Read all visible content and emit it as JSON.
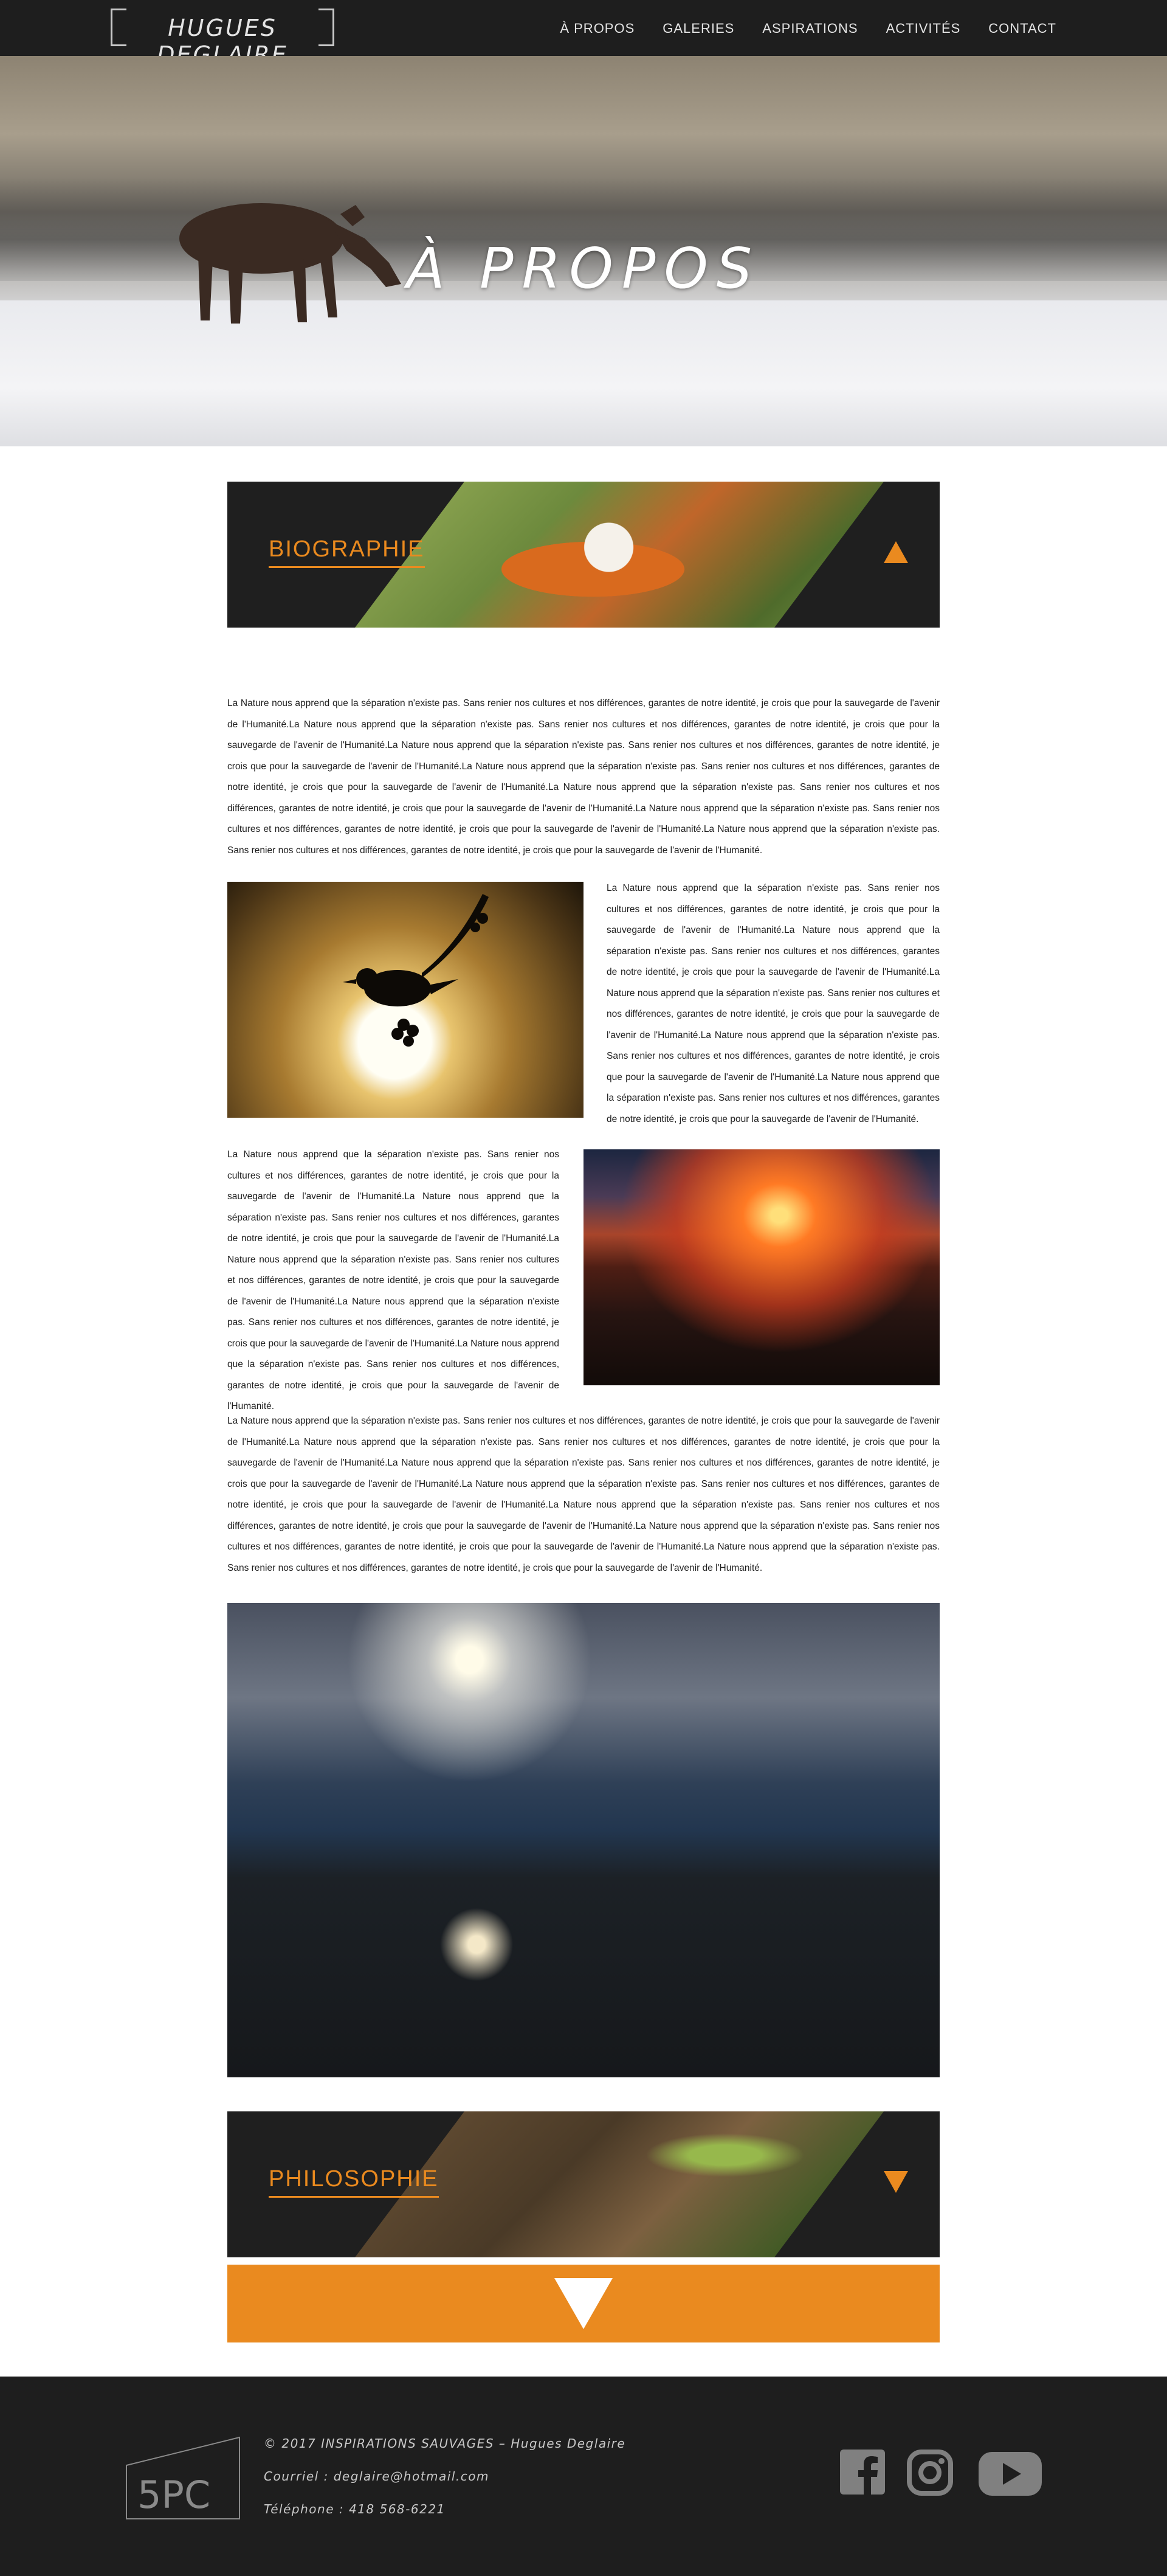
{
  "header": {
    "logo_text": "HUGUES DEGLAIRE",
    "nav": [
      "À PROPOS",
      "GALERIES",
      "ASPIRATIONS",
      "ACTIVITÉS",
      "CONTACT"
    ]
  },
  "hero": {
    "title": "À PROPOS"
  },
  "biography": {
    "label": "BIOGRAPHIE",
    "arrow_icon": "triangle-up-icon",
    "paragraph_1": "La Nature nous apprend que la séparation n'existe pas. Sans renier nos cultures et nos différences, garantes de notre identité, je crois que pour la sauvegarde de l'avenir de l'Humanité.La Nature nous apprend que la séparation n'existe pas. Sans renier nos cultures et nos différences, garantes de notre identité, je crois que pour la sauvegarde de l'avenir de l'Humanité.La Nature nous apprend que la séparation n'existe pas. Sans renier nos cultures et nos différences, garantes de notre identité, je crois que pour la sauvegarde de l'avenir de l'Humanité.La Nature nous apprend que la séparation n'existe pas. Sans renier nos cultures et nos différences, garantes de notre identité, je crois que pour la sauvegarde de l'avenir de l'Humanité.La Nature nous apprend que la séparation n'existe pas. Sans renier nos cultures et nos différences, garantes de notre identité, je crois que pour la sauvegarde de l'avenir de l'Humanité.La Nature nous apprend que la séparation n'existe pas. Sans renier nos cultures et nos différences, garantes de notre identité, je crois que pour la sauvegarde de l'avenir de l'Humanité.La Nature nous apprend que la séparation n'existe pas. Sans renier nos cultures et nos différences, garantes de notre identité, je crois que pour la sauvegarde de l'avenir de l'Humanité.",
    "paragraph_2": "La Nature nous apprend que la séparation n'existe pas. Sans renier nos cultures et nos différences, garantes de notre identité, je crois que pour la sauvegarde de l'avenir de l'Humanité.La Nature nous apprend que la séparation n'existe pas. Sans renier nos cultures et nos différences, garantes de notre identité, je crois que pour la sauvegarde de l'avenir de l'Humanité.La Nature nous apprend que la séparation n'existe pas. Sans renier nos cultures et nos différences, garantes de notre identité, je crois que pour la sauvegarde de l'avenir de l'Humanité.La Nature nous apprend que la séparation n'existe pas. Sans renier nos cultures et nos différences, garantes de notre identité, je crois que pour la sauvegarde de l'avenir de l'Humanité.La Nature nous apprend que la séparation n'existe pas. Sans renier nos cultures et nos différences, garantes de notre identité, je crois que pour la sauvegarde de l'avenir de l'Humanité.",
    "paragraph_3": "La Nature nous apprend que la séparation n'existe pas. Sans renier nos cultures et nos différences, garantes de notre identité, je crois que pour la sauvegarde de l'avenir de l'Humanité.La Nature nous apprend que la séparation n'existe pas. Sans renier nos cultures et nos différences, garantes de notre identité, je crois que pour la sauvegarde de l'avenir de l'Humanité.La Nature nous apprend que la séparation n'existe pas. Sans renier nos cultures et nos différences, garantes de notre identité, je crois que pour la sauvegarde de l'avenir de l'Humanité.La Nature nous apprend que la séparation n'existe pas. Sans renier nos cultures et nos différences, garantes de notre identité, je crois que pour la sauvegarde de l'avenir de l'Humanité.La Nature nous apprend que la séparation n'existe pas. Sans renier nos cultures et nos différences, garantes de notre identité, je crois que pour la sauvegarde de l'avenir de l'Humanité.",
    "paragraph_4": "La Nature nous apprend que la séparation n'existe pas. Sans renier nos cultures et nos différences, garantes de notre identité, je crois que pour la sauvegarde de l'avenir de l'Humanité.La Nature nous apprend que la séparation n'existe pas. Sans renier nos cultures et nos différences, garantes de notre identité, je crois que pour la sauvegarde de l'avenir de l'Humanité.La Nature nous apprend que la séparation n'existe pas. Sans renier nos cultures et nos différences, garantes de notre identité, je crois que pour la sauvegarde de l'avenir de l'Humanité.La Nature nous apprend que la séparation n'existe pas. Sans renier nos cultures et nos différences, garantes de notre identité, je crois que pour la sauvegarde de l'avenir de l'Humanité.La Nature nous apprend que la séparation n'existe pas. Sans renier nos cultures et nos différences, garantes de notre identité, je crois que pour la sauvegarde de l'avenir de l'Humanité.La Nature nous apprend que la séparation n'existe pas. Sans renier nos cultures et nos différences, garantes de notre identité, je crois que pour la sauvegarde de l'avenir de l'Humanité.La Nature nous apprend que la séparation n'existe pas. Sans renier nos cultures et nos différences, garantes de notre identité, je crois que pour la sauvegarde de l'avenir de l'Humanité."
  },
  "philosophy": {
    "label": "PHILOSOPHIE",
    "arrow_icon": "triangle-down-icon"
  },
  "cta": {
    "icon": "triangle-down-icon"
  },
  "footer": {
    "mark_text": "5PC",
    "copyright": "© 2017 INSPIRATIONS SAUVAGES – Hugues Deglaire",
    "email": "Courriel : deglaire@hotmail.com",
    "phone": "Téléphone : 418 568-6221",
    "social_icons": [
      "facebook-icon",
      "instagram-icon",
      "youtube-icon"
    ]
  },
  "colors": {
    "accent": "#ea8a1f",
    "dark": "#1e1e1e",
    "footer_text": "#c8c8c8"
  }
}
